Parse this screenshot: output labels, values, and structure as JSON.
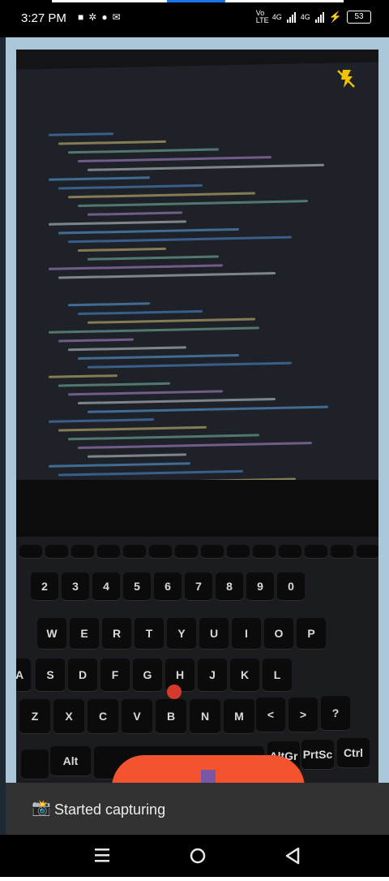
{
  "status_bar": {
    "time": "3:27 PM",
    "left_icons": [
      "video-camera-icon",
      "settings-icon",
      "chat-icon",
      "mail-icon"
    ],
    "network_1": "Vo LTE",
    "network_2": "4G",
    "network_3": "4G",
    "battery": "53"
  },
  "camera": {
    "flash_state": "flash-off-icon",
    "preview_description_keys": [
      "QWERTYUIOP",
      "ASDFGHJKL",
      "ZXCVBNM"
    ]
  },
  "keyboard": {
    "number_row": [
      "2",
      "3",
      "4",
      "5",
      "6",
      "7",
      "8",
      "9",
      "0"
    ],
    "row_q": [
      "W",
      "E",
      "R",
      "T",
      "Y",
      "U",
      "I",
      "O",
      "P"
    ],
    "row_a": [
      "S",
      "D",
      "F",
      "G",
      "H",
      "J",
      "K",
      "L"
    ],
    "row_z": [
      "Z",
      "X",
      "C",
      "V",
      "B",
      "N",
      "M"
    ],
    "row_z_left": "A",
    "alt_key": "Alt",
    "altgr_key": "AltGr",
    "prtsc_key": "PrtSc",
    "ctrl_key": "Ctrl"
  },
  "snackbar": {
    "icon": "📸",
    "message": "Started capturing"
  },
  "nav": {
    "recents": "recents-icon",
    "home": "home-icon",
    "back": "back-icon"
  },
  "colors": {
    "capture_button": "#f4532f",
    "stop_square": "#7a56a6",
    "app_background": "#a9c7d8",
    "snackbar": "#323232"
  }
}
